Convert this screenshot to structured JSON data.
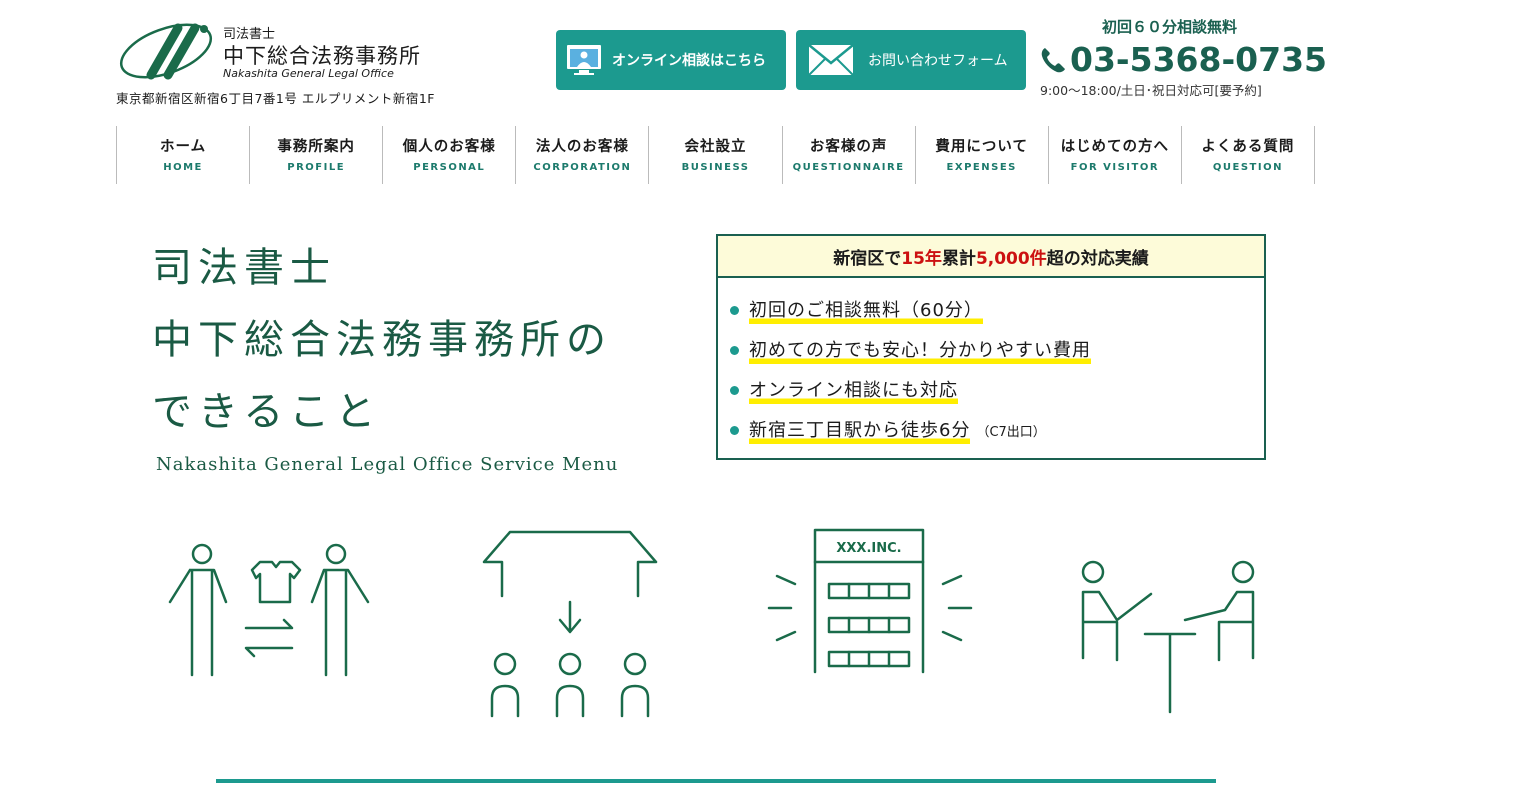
{
  "header": {
    "logo_sub": "司法書士",
    "logo_main": "中下総合法務事務所",
    "logo_en": "Nakashita General Legal Office",
    "address": "東京都新宿区新宿6丁目7番1号 エルプリメント新宿1F",
    "online_button": "オンライン相談はこちら",
    "contact_button": "お問い合わせフォーム",
    "tel_free": "初回６０分相談無料",
    "tel_number": "03-5368-0735",
    "tel_hours": "9:00～18:00/土日･祝日対応可[要予約]"
  },
  "nav": [
    {
      "jp": "ホーム",
      "en": "HOME"
    },
    {
      "jp": "事務所案内",
      "en": "PROFILE"
    },
    {
      "jp": "個人のお客様",
      "en": "PERSONAL"
    },
    {
      "jp": "法人のお客様",
      "en": "CORPORATION"
    },
    {
      "jp": "会社設立",
      "en": "BUSINESS"
    },
    {
      "jp": "お客様の声",
      "en": "QUESTIONNAIRE"
    },
    {
      "jp": "費用について",
      "en": "EXPENSES"
    },
    {
      "jp": "はじめての方へ",
      "en": "FOR VISITOR"
    },
    {
      "jp": "よくある質問",
      "en": "QUESTION"
    }
  ],
  "hero": {
    "title_line1": "司法書士",
    "title_line2": "中下総合法務事務所の",
    "title_line3": "できること",
    "subtitle_en": "Nakashita General Legal Office Service Menu"
  },
  "record": {
    "head_pre": "新宿区で",
    "head_years": "15年",
    "head_mid": " 累計",
    "head_count": "5,000件",
    "head_post": "超の対応実績",
    "items": [
      {
        "text": "初回のご相談無料（60分）",
        "note": ""
      },
      {
        "text": "初めての方でも安心！分かりやすい費用",
        "note": ""
      },
      {
        "text": "オンライン相談にも対応",
        "note": ""
      },
      {
        "text": "新宿三丁目駅から徒歩6分",
        "note": "（C7出口）"
      }
    ]
  },
  "illustrations": {
    "company_sign": "XXX.INC."
  },
  "colors": {
    "accent": "#1c9a8f",
    "dark_green": "#1a5a44",
    "highlight": "#ffee00",
    "red": "#cc1111"
  }
}
